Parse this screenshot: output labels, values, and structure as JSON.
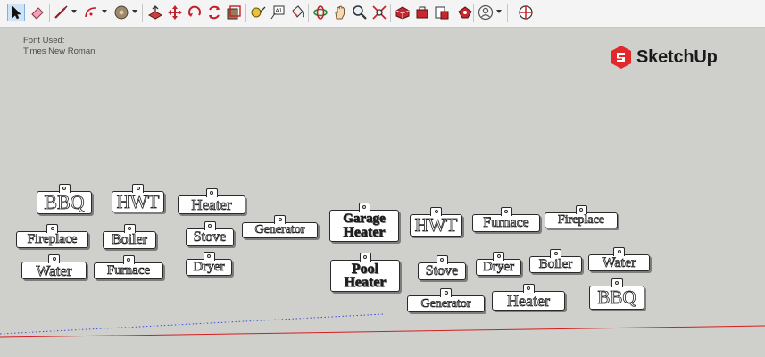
{
  "toolbar": {
    "tools": [
      {
        "name": "select-tool-icon",
        "active": true
      },
      {
        "name": "eraser-tool-icon"
      },
      {
        "name": "line-tool-icon",
        "dropdown": true
      },
      {
        "name": "arc-tool-icon",
        "dropdown": true
      },
      {
        "name": "shape-tool-icon",
        "dropdown": true
      },
      {
        "name": "push-pull-tool-icon"
      },
      {
        "name": "move-tool-icon"
      },
      {
        "name": "rotate-tool-icon"
      },
      {
        "name": "scale-tool-icon"
      },
      {
        "name": "offset-tool-icon"
      },
      {
        "name": "tape-measure-tool-icon"
      },
      {
        "name": "text-tool-icon"
      },
      {
        "name": "paint-bucket-tool-icon"
      },
      {
        "name": "orbit-tool-icon"
      },
      {
        "name": "pan-tool-icon"
      },
      {
        "name": "zoom-tool-icon"
      },
      {
        "name": "zoom-extents-tool-icon"
      },
      {
        "name": "3d-warehouse-icon"
      },
      {
        "name": "extension-warehouse-icon"
      },
      {
        "name": "send-to-layout-icon"
      },
      {
        "name": "extension-manager-icon"
      },
      {
        "name": "account-icon",
        "dropdown": true
      },
      {
        "name": "model-info-icon"
      }
    ]
  },
  "viewport": {
    "font_note_line1": "Font Used:",
    "font_note_line2": "Times New Roman",
    "logo_text": "SketchUp",
    "brand_color": "#e3282b"
  },
  "left_group": [
    {
      "label": "BBQ",
      "style": "outline"
    },
    {
      "label": "HWT",
      "style": "outline"
    },
    {
      "label": "Heater",
      "style": "outline"
    },
    {
      "label": "Fireplace",
      "style": "outline"
    },
    {
      "label": "Boiler",
      "style": "outline"
    },
    {
      "label": "Stove",
      "style": "outline"
    },
    {
      "label": "Generator",
      "style": "outline"
    },
    {
      "label": "Water",
      "style": "outline"
    },
    {
      "label": "Furnace",
      "style": "outline"
    },
    {
      "label": "Dryer",
      "style": "outline"
    }
  ],
  "right_group": [
    {
      "label_line1": "Garage",
      "label_line2": "Heater",
      "style": "dark"
    },
    {
      "label": "HWT",
      "style": "outline"
    },
    {
      "label": "Furnace",
      "style": "outline"
    },
    {
      "label": "Fireplace",
      "style": "outline"
    },
    {
      "label_line1": "Pool",
      "label_line2": "Heater",
      "style": "dark"
    },
    {
      "label": "Stove",
      "style": "outline"
    },
    {
      "label": "Dryer",
      "style": "outline"
    },
    {
      "label": "Boiler",
      "style": "outline"
    },
    {
      "label": "Water",
      "style": "outline"
    },
    {
      "label": "Generator",
      "style": "outline"
    },
    {
      "label": "Heater",
      "style": "outline"
    },
    {
      "label": "BBQ",
      "style": "outline"
    }
  ]
}
